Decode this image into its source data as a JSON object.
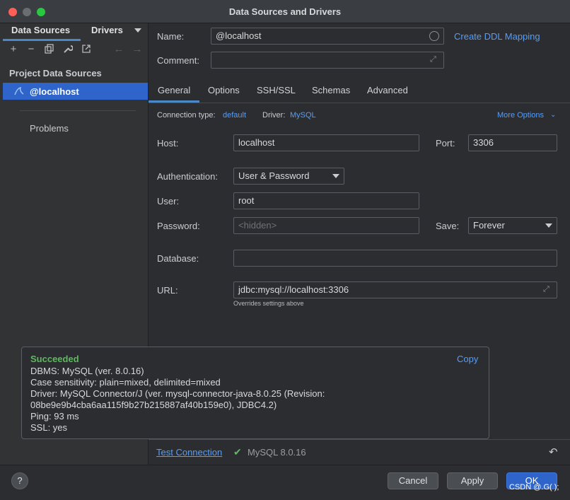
{
  "window": {
    "title": "Data Sources and Drivers"
  },
  "sidebar": {
    "tab_data_sources": "Data Sources",
    "tab_drivers": "Drivers",
    "section_title": "Project Data Sources",
    "selected_item": "@localhost",
    "problems": "Problems"
  },
  "header": {
    "name_label": "Name:",
    "name_value": "@localhost",
    "comment_label": "Comment:",
    "create_ddl": "Create DDL Mapping"
  },
  "tabs": [
    "General",
    "Options",
    "SSH/SSL",
    "Schemas",
    "Advanced"
  ],
  "general": {
    "conn_type_label": "Connection type:",
    "conn_type_value": "default",
    "driver_label": "Driver:",
    "driver_value": "MySQL",
    "more_options": "More Options",
    "host_label": "Host:",
    "host_value": "localhost",
    "port_label": "Port:",
    "port_value": "3306",
    "auth_label": "Authentication:",
    "auth_value": "User & Password",
    "user_label": "User:",
    "user_value": "root",
    "password_label": "Password:",
    "password_placeholder": "<hidden>",
    "save_label": "Save:",
    "save_value": "Forever",
    "database_label": "Database:",
    "url_label": "URL:",
    "url_value": "jdbc:mysql://localhost:3306",
    "url_hint": "Overrides settings above"
  },
  "popup": {
    "status": "Succeeded",
    "copy": "Copy",
    "lines": [
      "DBMS: MySQL (ver. 8.0.16)",
      "Case sensitivity: plain=mixed, delimited=mixed",
      "Driver: MySQL Connector/J (ver. mysql-connector-java-8.0.25 (Revision:",
      "08be9e9b4cba6aa115f9b27b215887af40b159e0), JDBC4.2)",
      "Ping: 93 ms",
      "SSL: yes"
    ]
  },
  "test": {
    "link": "Test Connection",
    "result": "MySQL 8.0.16"
  },
  "buttons": {
    "help": "?",
    "cancel": "Cancel",
    "apply": "Apply",
    "ok": "OK"
  },
  "watermark": "CSDN @.G( );",
  "colors": {
    "accent": "#589df6",
    "success": "#5fb85f",
    "selection": "#2f65ca"
  }
}
